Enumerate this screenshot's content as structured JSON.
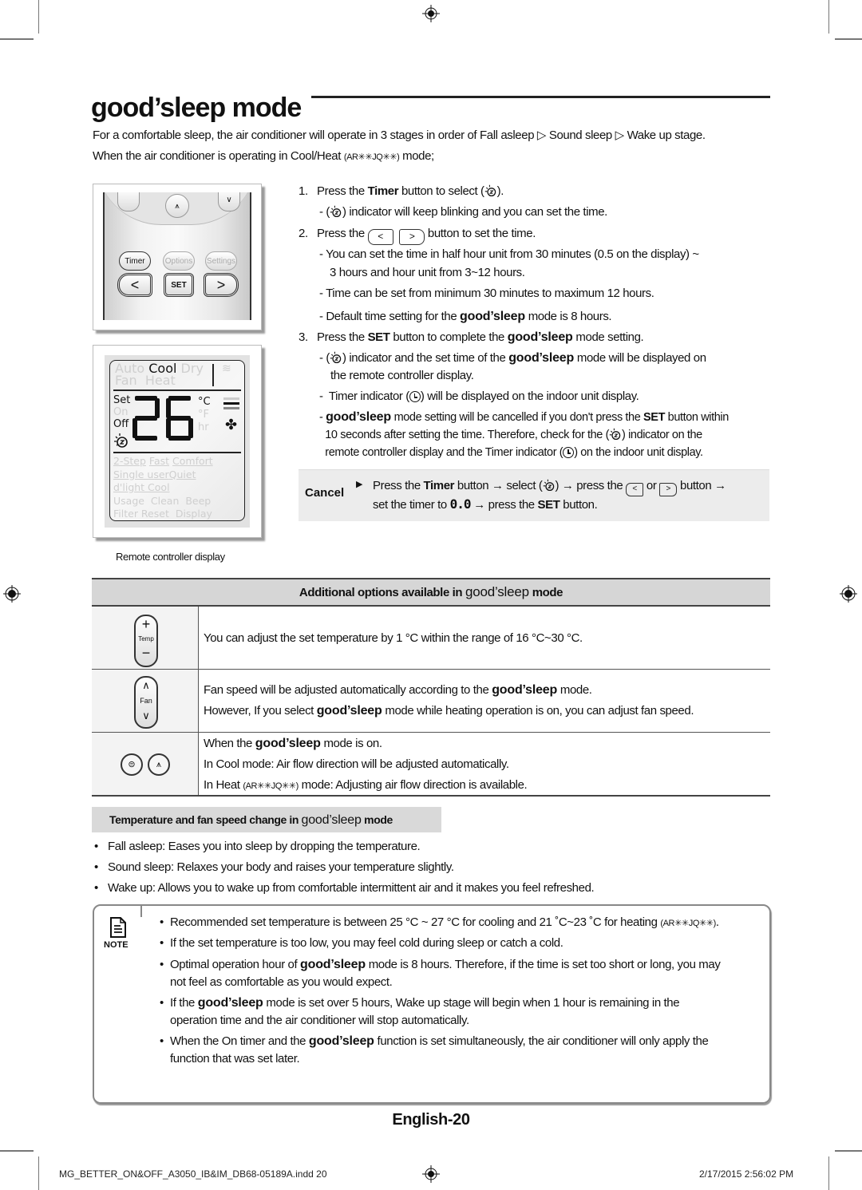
{
  "page": {
    "title": "good’sleep mode",
    "intro_line1_prefix": "For a comfortable sleep, the air conditioner will operate in 3 stages in order of",
    "stages": [
      "Fall asleep",
      "Sound sleep",
      "Wake up stage."
    ],
    "intro_line2_prefix": "When the air conditioner is operating in Cool/Heat",
    "model_code": "(AR✳✳JQ✳✳)",
    "intro_line2_suffix": "mode;",
    "brand_mode": "good’sleep"
  },
  "remote_image": {
    "buttons": {
      "timer": "Timer",
      "options": "Options",
      "settings": "Settings",
      "set": "SET",
      "left": "<",
      "right": ">"
    }
  },
  "remote_display": {
    "caption": "Remote controller display",
    "modes_top": [
      "Auto",
      "Cool",
      "Dry"
    ],
    "modes_bottom": [
      "Fan",
      "Heat"
    ],
    "active_mode": "Cool",
    "labels_left": [
      "Set",
      "On",
      "Off"
    ],
    "temperature": "26",
    "units": [
      "°C",
      "°F",
      "hr"
    ],
    "options_rows": [
      [
        "2-Step",
        "Fast",
        "Comfort"
      ],
      [
        "Single user",
        "Quiet"
      ],
      [
        "d'light Cool"
      ],
      [
        "Usage",
        "Clean",
        "Beep"
      ],
      [
        "Filter Reset",
        "Display"
      ]
    ]
  },
  "steps": [
    {
      "num": "1.",
      "pre": "Press the",
      "bold": "Timer",
      "post": "button to select (",
      "end": ")."
    },
    {
      "num": "2.",
      "pre": "Press the",
      "post": "button to set the time."
    },
    {
      "num": "3.",
      "pre": "Press the",
      "bold": "SET",
      "post": "button to complete the",
      "gs": "good’sleep",
      "end": "mode setting."
    }
  ],
  "step1_sub": "indicator will keep blinking and you can set the time.",
  "step2_subs": [
    "You can set the time in half hour unit from 30 minutes (0.5 on the display) ~",
    "3 hours and hour unit from 3~12 hours.",
    "Time can be set from minimum 30 minutes to maximum 12 hours.",
    "Default time setting for the",
    "mode is 8 hours."
  ],
  "step3_subs": {
    "a1": "indicator and the set time of the",
    "a2": "mode will be displayed on",
    "a3": "the remote controller display.",
    "b1": "Timer indicator (",
    "b2": ") will be displayed on the indoor unit display.",
    "c1": "mode setting will be cancelled if you don't press the",
    "c_bold": "SET",
    "c2": "button within",
    "c3": "10 seconds after setting the time. Therefore, check for the (",
    "c4": ") indicator on the",
    "c5": "remote controller display and the Timer indicator (",
    "c6": ") on the indoor unit display."
  },
  "cancel": {
    "label": "Cancel",
    "l1_pre": "Press the",
    "l1_bold": "Timer",
    "l1_a": "button → select (",
    "l1_b": ") → press the",
    "l1_or": "or",
    "l1_c": "button →",
    "l2_pre": "set the timer to",
    "timer_value": "0.0",
    "l2_mid": "→ press the",
    "l2_bold": "SET",
    "l2_end": "button."
  },
  "options_table": {
    "header_pre": "Additional options available in",
    "header_post": "mode",
    "rows": [
      {
        "icon": "temp-button",
        "icon_label": "Temp",
        "lines": [
          "You can adjust the set temperature by 1 °C within the range of 16 °C~30 °C."
        ]
      },
      {
        "icon": "fan-button",
        "icon_label": "Fan",
        "l1_pre": "Fan speed will be adjusted automatically according to the",
        "l1_post": "mode.",
        "l2_pre": "However, If you select",
        "l2_post": "mode while heating operation is on, you can adjust fan speed."
      },
      {
        "icon": "airflow-buttons",
        "l1_pre": "When the",
        "l1_post": "mode is on.",
        "l2": "In Cool mode: Air flow direction will be adjusted automatically.",
        "l3_pre": "In Heat",
        "l3_post": "mode: Adjusting air flow direction is available."
      }
    ]
  },
  "temp_section": {
    "header_pre": "Temperature and fan speed change in",
    "header_post": "mode",
    "bullets": [
      "Fall asleep: Eases you into sleep by dropping the temperature.",
      "Sound sleep: Relaxes your body and raises your temperature slightly.",
      "Wake up: Allows you to wake up from comfortable intermittent air and it makes you feel refreshed."
    ]
  },
  "note": {
    "label": "NOTE",
    "b1": "Recommended set temperature is between  25 °C ~ 27 °C for cooling and 21 ˚C~23 ˚C for heating",
    "b1_end": ".",
    "b2": "If the set temperature is too low, you may feel cold during sleep or catch a cold.",
    "b3_pre": "Optimal operation hour of",
    "b3_post": "mode is 8 hours. Therefore, if the time is set too short or long, you may",
    "b3_l2": "not feel as comfortable as you would expect.",
    "b4_pre": "If the",
    "b4_post": "mode is set over 5 hours, Wake up stage will begin when 1 hour is remaining in the",
    "b4_l2": "operation time and the air conditioner will stop automatically.",
    "b5_pre": "When the On timer and the",
    "b5_post": "function is set simultaneously, the air conditioner will only apply the",
    "b5_l2": "function that was set later."
  },
  "page_number": "English-20",
  "footer": {
    "file": "MG_BETTER_ON&OFF_A3050_IB&IM_DB68-05189A.indd   20",
    "timestamp": "2/17/2015   2:56:02 PM"
  }
}
